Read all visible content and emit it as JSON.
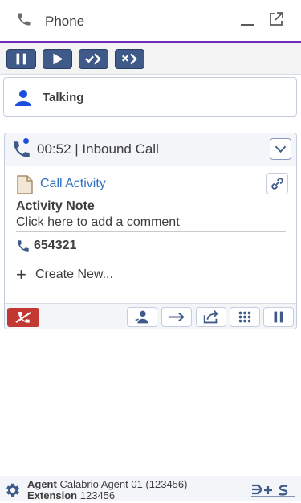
{
  "header": {
    "title": "Phone"
  },
  "toolbar": {
    "buttons": [
      "pause-icon",
      "play-icon",
      "next-check-icon",
      "next-x-icon"
    ]
  },
  "status": {
    "label": "Talking"
  },
  "call": {
    "header_title": "00:52 | Inbound Call",
    "activity_label": "Call Activity",
    "note_title": "Activity Note",
    "note_hint": "Click here to add a comment",
    "number": "654321",
    "create_new": "Create New...",
    "footer_buttons": [
      "consult-icon",
      "transfer-icon",
      "share-icon",
      "keypad-icon",
      "hold-icon"
    ]
  },
  "footer": {
    "agent_label": "Agent",
    "agent_value": "Calabrio Agent 01 (123456)",
    "extension_label": "Extension",
    "extension_value": "123456"
  },
  "colors": {
    "accent_purple": "#6b2bb5",
    "toolbar_button": "#3f5a88",
    "link_blue": "#2f6fbf",
    "status_blue": "#1a4fe0",
    "hangup_red": "#c23934"
  }
}
